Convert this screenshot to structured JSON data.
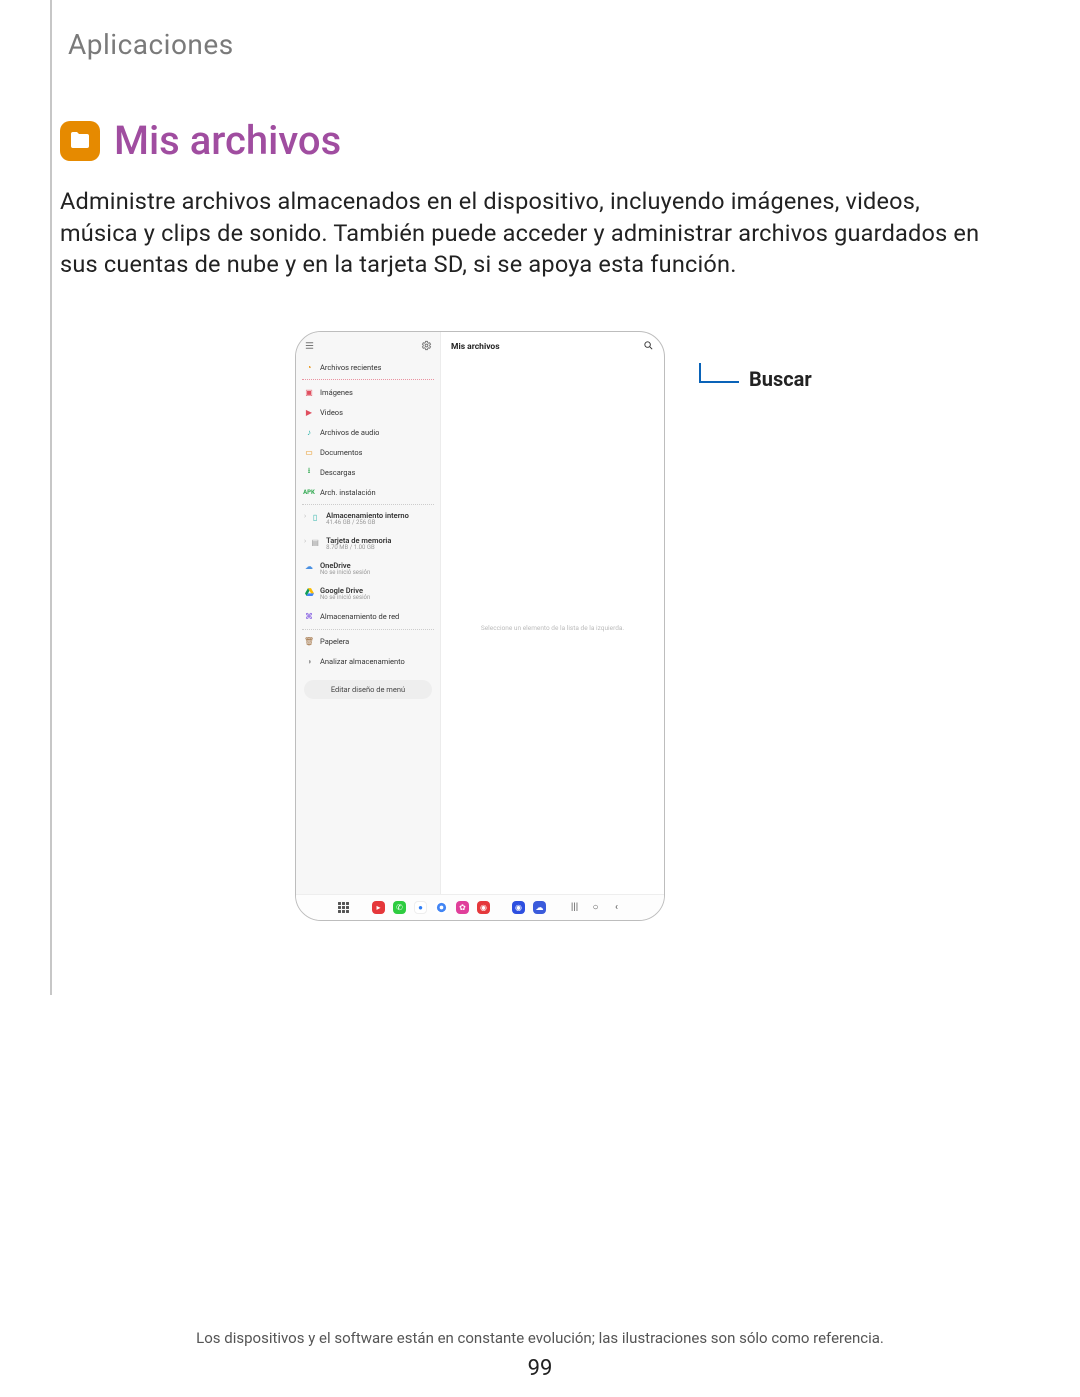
{
  "breadcrumb": "Aplicaciones",
  "title": "Mis archivos",
  "description": "Administre archivos almacenados en el dispositivo, incluyendo imágenes, videos, música y clips de sonido. También puede acceder y administrar archivos guardados en sus cuentas de nube y en la tarjeta SD, si se apoya esta función.",
  "callout": {
    "search": "Buscar"
  },
  "device": {
    "sidebar": {
      "recent": "Archivos recientes",
      "images": "Imágenes",
      "videos": "Videos",
      "audio": "Archivos de audio",
      "documents": "Documentos",
      "downloads": "Descargas",
      "apk": "Arch. instalación",
      "internal": {
        "label": "Almacenamiento interno",
        "sub": "41.46 GB / 256 GB"
      },
      "sdcard": {
        "label": "Tarjeta de memoria",
        "sub": "8.70 MB / 1.00 GB"
      },
      "onedrive": {
        "label": "OneDrive",
        "sub": "No se inició sesión"
      },
      "gdrive": {
        "label": "Google Drive",
        "sub": "No se inició sesión"
      },
      "network": "Almacenamiento de red",
      "trash": "Papelera",
      "analyze": "Analizar almacenamiento",
      "editLayout": "Editar diseño de menú"
    },
    "main": {
      "title": "Mis archivos",
      "emptyHint": "Seleccione un elemento de la lista de la izquierda."
    }
  },
  "footer": "Los dispositivos y el software están en constante evolución; las ilustraciones son sólo como referencia.",
  "pageNumber": "99"
}
